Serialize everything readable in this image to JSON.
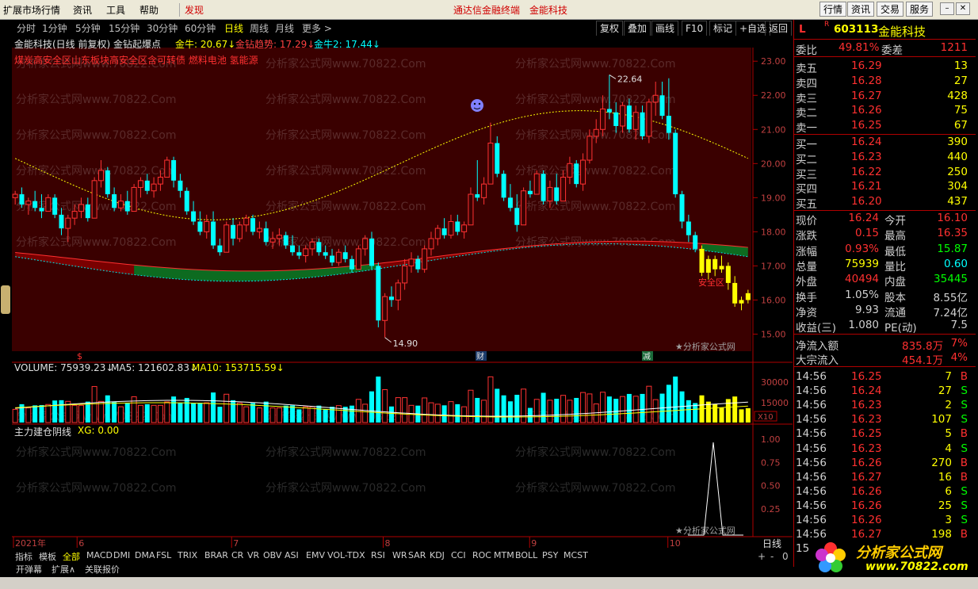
{
  "menubar": {
    "items": [
      "扩展市场行情",
      "资讯",
      "工具",
      "帮助"
    ],
    "discover": "发现",
    "center_title": "通达信金融终端",
    "center_stock": "金能科技",
    "right_buttons": [
      "行情",
      "资讯",
      "交易",
      "服务"
    ]
  },
  "periods": {
    "items": [
      "分时",
      "1分钟",
      "5分钟",
      "15分钟",
      "30分钟",
      "60分钟",
      "日线",
      "周线",
      "月线",
      "更多 >"
    ],
    "active": "日线",
    "right_buttons": [
      "复权",
      "叠加",
      "画线",
      "F10",
      "标记",
      "+自选",
      "返回"
    ]
  },
  "chart_header": {
    "title": "金能科技(日线 前复权) 金钻起爆点",
    "j1": "金牛: 20.67↓",
    "j2": "金钻趋势: 17.29↓",
    "j3": "金牛2: 17.44↓",
    "concepts": "煤炭高安全区山东板块高安全区含可转债 燃料电池 氢能源",
    "label_high": "22.64",
    "label_low": "14.90",
    "safe_zone": "安全区",
    "marker_s": "$",
    "marker_cai": "财",
    "marker_jian": "减",
    "watermark_right": "★分析家公式网"
  },
  "volume": {
    "label": "VOLUME: 75939.23↓",
    "ma5": "MA5: 121602.83↓",
    "ma10": "MA10: 153715.59↓",
    "axis": [
      "30000",
      "15000",
      "X10"
    ]
  },
  "indicator": {
    "name": "主力建仓阴线",
    "xg": "XG: 0.00",
    "axis": [
      "1.00",
      "0.75",
      "0.50",
      "0.25"
    ]
  },
  "time_axis": [
    "2021年",
    "6",
    "7",
    "8",
    "9",
    "10"
  ],
  "price_axis": [
    "23.00",
    "22.00",
    "21.00",
    "20.00",
    "19.00",
    "18.00",
    "17.00",
    "16.00",
    "15.00"
  ],
  "watermark": {
    "site": "分析家公式网www.70822.Com",
    "logo_text": "分析家公式网",
    "logo_url": "www.70822.com"
  },
  "quote": {
    "flag": "L",
    "r": "R",
    "code": "603113",
    "name": "金能科技",
    "weibi_label": "委比",
    "weibi": "49.81%",
    "weicha_label": "委差",
    "weicha": "1211",
    "asks": [
      {
        "label": "卖五",
        "price": "16.29",
        "vol": "13"
      },
      {
        "label": "卖四",
        "price": "16.28",
        "vol": "27"
      },
      {
        "label": "卖三",
        "price": "16.27",
        "vol": "428"
      },
      {
        "label": "卖二",
        "price": "16.26",
        "vol": "75"
      },
      {
        "label": "卖一",
        "price": "16.25",
        "vol": "67"
      }
    ],
    "bids": [
      {
        "label": "买一",
        "price": "16.24",
        "vol": "390"
      },
      {
        "label": "买二",
        "price": "16.23",
        "vol": "440"
      },
      {
        "label": "买三",
        "price": "16.22",
        "vol": "250"
      },
      {
        "label": "买四",
        "price": "16.21",
        "vol": "304"
      },
      {
        "label": "买五",
        "price": "16.20",
        "vol": "437"
      }
    ],
    "stats": [
      {
        "l1": "现价",
        "v1": "16.24",
        "l2": "今开",
        "v2": "16.10"
      },
      {
        "l1": "涨跌",
        "v1": "0.15",
        "l2": "最高",
        "v2": "16.35"
      },
      {
        "l1": "涨幅",
        "v1": "0.93%",
        "l2": "最低",
        "v2": "15.87"
      },
      {
        "l1": "总量",
        "v1": "75939",
        "l2": "量比",
        "v2": "0.60"
      },
      {
        "l1": "外盘",
        "v1": "40494",
        "l2": "内盘",
        "v2": "35445"
      },
      {
        "l1": "换手",
        "v1": "1.05%",
        "l2": "股本",
        "v2": "8.55亿"
      },
      {
        "l1": "净资",
        "v1": "9.93",
        "l2": "流通",
        "v2": "7.24亿"
      },
      {
        "l1": "收益(三)",
        "v1": "1.080",
        "l2": "PE(动)",
        "v2": "7.5"
      }
    ],
    "flow": [
      {
        "label": "净流入额",
        "value": "835.8万",
        "pct": "7%"
      },
      {
        "label": "大宗流入",
        "value": "454.1万",
        "pct": "4%"
      }
    ],
    "ticks": [
      {
        "t": "14:56",
        "p": "16.25",
        "v": "7",
        "s": "B"
      },
      {
        "t": "14:56",
        "p": "16.24",
        "v": "27",
        "s": "S"
      },
      {
        "t": "14:56",
        "p": "16.23",
        "v": "2",
        "s": "S"
      },
      {
        "t": "14:56",
        "p": "16.23",
        "v": "107",
        "s": "S"
      },
      {
        "t": "14:56",
        "p": "16.25",
        "v": "5",
        "s": "B"
      },
      {
        "t": "14:56",
        "p": "16.23",
        "v": "4",
        "s": "S"
      },
      {
        "t": "14:56",
        "p": "16.26",
        "v": "270",
        "s": "B"
      },
      {
        "t": "14:56",
        "p": "16.27",
        "v": "16",
        "s": "B"
      },
      {
        "t": "14:56",
        "p": "16.26",
        "v": "6",
        "s": "S"
      },
      {
        "t": "14:56",
        "p": "16.26",
        "v": "25",
        "s": "S"
      },
      {
        "t": "14:56",
        "p": "16.26",
        "v": "3",
        "s": "S"
      },
      {
        "t": "14:56",
        "p": "16.27",
        "v": "198",
        "s": "B"
      },
      {
        "t": "15:00",
        "p": "",
        "v": "",
        "s": ""
      }
    ],
    "bottom_label": "日线"
  },
  "tabs": {
    "items": [
      "指标",
      "模板",
      "全部",
      "MACD",
      "DMI",
      "DMA",
      "FSL",
      "TRIX",
      "BRAR",
      "CR",
      "VR",
      "OBV",
      "ASI",
      "EMV",
      "VOL-TDX",
      "RSI",
      "WR",
      "SAR",
      "KDJ",
      "CCI",
      "ROC",
      "MTM",
      "BOLL",
      "PSY",
      "MCST"
    ],
    "active": "全部",
    "status": [
      "开弹幕",
      "扩展∧",
      "关联报价"
    ],
    "corner": [
      "+",
      "-",
      "0"
    ]
  },
  "colors": {
    "up": "#ff3232",
    "down": "#00ffff",
    "yellow": "#ffff00",
    "bg_red": "#3a0000"
  },
  "chart_data": {
    "type": "candlestick",
    "price_range": [
      14.5,
      23.4
    ],
    "candles": [
      [
        19.0,
        19.2,
        18.8,
        19.1
      ],
      [
        19.1,
        19.3,
        18.7,
        18.8
      ],
      [
        18.8,
        19.0,
        18.5,
        18.9
      ],
      [
        18.9,
        19.2,
        18.6,
        18.7
      ],
      [
        18.7,
        19.1,
        18.4,
        18.6
      ],
      [
        18.6,
        19.1,
        18.6,
        19.0
      ],
      [
        19.0,
        19.1,
        18.4,
        18.5
      ],
      [
        18.5,
        18.7,
        17.9,
        18.1
      ],
      [
        18.1,
        18.5,
        17.7,
        18.4
      ],
      [
        18.4,
        18.8,
        18.2,
        18.6
      ],
      [
        18.6,
        19.0,
        18.4,
        18.8
      ],
      [
        18.8,
        19.0,
        18.3,
        18.4
      ],
      [
        18.4,
        19.6,
        18.4,
        19.5
      ],
      [
        19.5,
        20.1,
        19.3,
        19.8
      ],
      [
        19.8,
        19.9,
        19.0,
        19.1
      ],
      [
        19.1,
        19.3,
        18.6,
        18.7
      ],
      [
        18.7,
        19.1,
        18.6,
        18.9
      ],
      [
        18.9,
        19.2,
        18.5,
        18.6
      ],
      [
        18.6,
        19.4,
        18.6,
        19.3
      ],
      [
        19.3,
        19.6,
        19.0,
        19.5
      ],
      [
        19.5,
        19.7,
        19.1,
        19.2
      ],
      [
        19.2,
        19.6,
        19.0,
        19.4
      ],
      [
        19.4,
        19.8,
        19.2,
        19.6
      ],
      [
        19.6,
        20.2,
        19.6,
        20.1
      ],
      [
        20.1,
        20.2,
        19.3,
        19.5
      ],
      [
        19.5,
        19.7,
        19.0,
        19.2
      ],
      [
        19.2,
        19.3,
        18.5,
        18.6
      ],
      [
        18.6,
        18.9,
        18.2,
        18.3
      ],
      [
        18.3,
        18.6,
        17.9,
        18.0
      ],
      [
        18.0,
        18.5,
        17.8,
        18.3
      ],
      [
        18.3,
        18.6,
        17.5,
        17.6
      ],
      [
        17.6,
        17.8,
        17.3,
        17.4
      ],
      [
        17.4,
        18.3,
        17.4,
        18.2
      ],
      [
        18.2,
        18.4,
        17.6,
        17.8
      ],
      [
        17.8,
        18.3,
        17.7,
        18.2
      ],
      [
        18.2,
        18.5,
        18.0,
        18.4
      ],
      [
        18.4,
        18.5,
        17.9,
        18.0
      ],
      [
        18.0,
        18.3,
        17.8,
        18.1
      ],
      [
        18.1,
        18.3,
        17.6,
        17.7
      ],
      [
        17.7,
        18.0,
        17.5,
        17.8
      ],
      [
        17.8,
        18.1,
        17.6,
        17.9
      ],
      [
        17.9,
        18.0,
        17.5,
        17.6
      ],
      [
        17.6,
        17.9,
        17.3,
        17.4
      ],
      [
        17.4,
        17.6,
        17.2,
        17.3
      ],
      [
        17.3,
        17.6,
        17.1,
        17.5
      ],
      [
        17.5,
        17.8,
        17.3,
        17.7
      ],
      [
        17.7,
        17.8,
        17.3,
        17.4
      ],
      [
        17.4,
        17.6,
        17.2,
        17.3
      ],
      [
        17.3,
        17.5,
        17.0,
        17.1
      ],
      [
        17.1,
        17.5,
        17.0,
        17.4
      ],
      [
        17.4,
        17.6,
        17.1,
        17.2
      ],
      [
        17.2,
        17.3,
        16.8,
        16.9
      ],
      [
        16.9,
        17.6,
        16.9,
        17.5
      ],
      [
        17.5,
        17.9,
        17.3,
        17.8
      ],
      [
        17.8,
        18.0,
        16.9,
        17.0
      ],
      [
        17.0,
        17.1,
        15.2,
        15.4
      ],
      [
        15.4,
        16.2,
        14.9,
        16.1
      ],
      [
        16.1,
        16.4,
        15.8,
        16.0
      ],
      [
        16.0,
        16.6,
        15.7,
        16.5
      ],
      [
        16.5,
        17.2,
        16.3,
        17.0
      ],
      [
        17.0,
        17.4,
        16.8,
        17.2
      ],
      [
        17.2,
        17.3,
        16.8,
        16.9
      ],
      [
        16.9,
        17.6,
        16.8,
        17.5
      ],
      [
        17.5,
        18.0,
        17.3,
        17.8
      ],
      [
        17.8,
        18.2,
        17.6,
        18.1
      ],
      [
        18.1,
        18.4,
        17.8,
        17.9
      ],
      [
        17.9,
        18.5,
        17.8,
        18.3
      ],
      [
        18.3,
        18.5,
        17.9,
        18.0
      ],
      [
        18.0,
        18.3,
        17.8,
        18.2
      ],
      [
        18.2,
        19.3,
        18.2,
        19.1
      ],
      [
        19.1,
        20.1,
        18.9,
        19.0
      ],
      [
        19.0,
        19.6,
        18.8,
        19.4
      ],
      [
        19.4,
        21.2,
        19.4,
        20.6
      ],
      [
        20.6,
        20.8,
        19.6,
        19.7
      ],
      [
        19.7,
        19.8,
        18.9,
        19.0
      ],
      [
        19.0,
        19.4,
        18.6,
        18.7
      ],
      [
        18.7,
        19.1,
        18.0,
        18.2
      ],
      [
        18.2,
        19.3,
        18.2,
        19.2
      ],
      [
        19.2,
        19.5,
        19.0,
        19.1
      ],
      [
        19.1,
        19.8,
        19.1,
        19.7
      ],
      [
        19.7,
        19.8,
        18.8,
        18.9
      ],
      [
        18.9,
        19.5,
        18.7,
        19.3
      ],
      [
        19.3,
        19.7,
        18.8,
        18.9
      ],
      [
        18.9,
        19.8,
        18.9,
        19.6
      ],
      [
        19.6,
        20.2,
        19.4,
        20.0
      ],
      [
        20.0,
        20.1,
        19.3,
        19.4
      ],
      [
        19.4,
        20.3,
        19.2,
        20.1
      ],
      [
        20.1,
        21.0,
        20.0,
        20.8
      ],
      [
        20.8,
        21.3,
        20.6,
        21.0
      ],
      [
        21.0,
        22.0,
        20.8,
        21.6
      ],
      [
        21.6,
        22.6,
        21.3,
        21.5
      ],
      [
        21.5,
        21.8,
        20.9,
        21.1
      ],
      [
        21.1,
        21.8,
        20.9,
        21.7
      ],
      [
        21.7,
        21.9,
        20.9,
        21.0
      ],
      [
        21.0,
        21.7,
        20.7,
        21.5
      ],
      [
        21.5,
        21.7,
        20.7,
        20.8
      ],
      [
        20.8,
        21.9,
        20.6,
        21.8
      ],
      [
        21.8,
        22.4,
        21.4,
        22.0
      ],
      [
        22.0,
        22.4,
        21.3,
        21.4
      ],
      [
        21.4,
        22.5,
        20.7,
        20.9
      ],
      [
        20.9,
        21.0,
        19.0,
        19.1
      ],
      [
        19.1,
        19.2,
        18.1,
        18.3
      ],
      [
        18.3,
        18.5,
        17.7,
        17.9
      ],
      [
        17.9,
        18.0,
        17.4,
        17.5
      ],
      [
        17.5,
        17.6,
        16.7,
        16.8
      ],
      [
        16.8,
        17.3,
        16.6,
        17.2
      ],
      [
        17.2,
        17.3,
        16.7,
        16.9
      ],
      [
        16.9,
        17.3,
        16.8,
        17.0
      ],
      [
        17.0,
        17.1,
        16.3,
        16.5
      ],
      [
        16.5,
        16.7,
        15.8,
        15.9
      ],
      [
        15.9,
        16.1,
        15.7,
        16.0
      ],
      [
        16.0,
        16.3,
        15.9,
        16.2
      ]
    ],
    "volume_ma": {
      "VOLUME": 75939.23,
      "MA5": 121602.83,
      "MA10": 153715.59
    },
    "indicator_xg": 0.0
  }
}
